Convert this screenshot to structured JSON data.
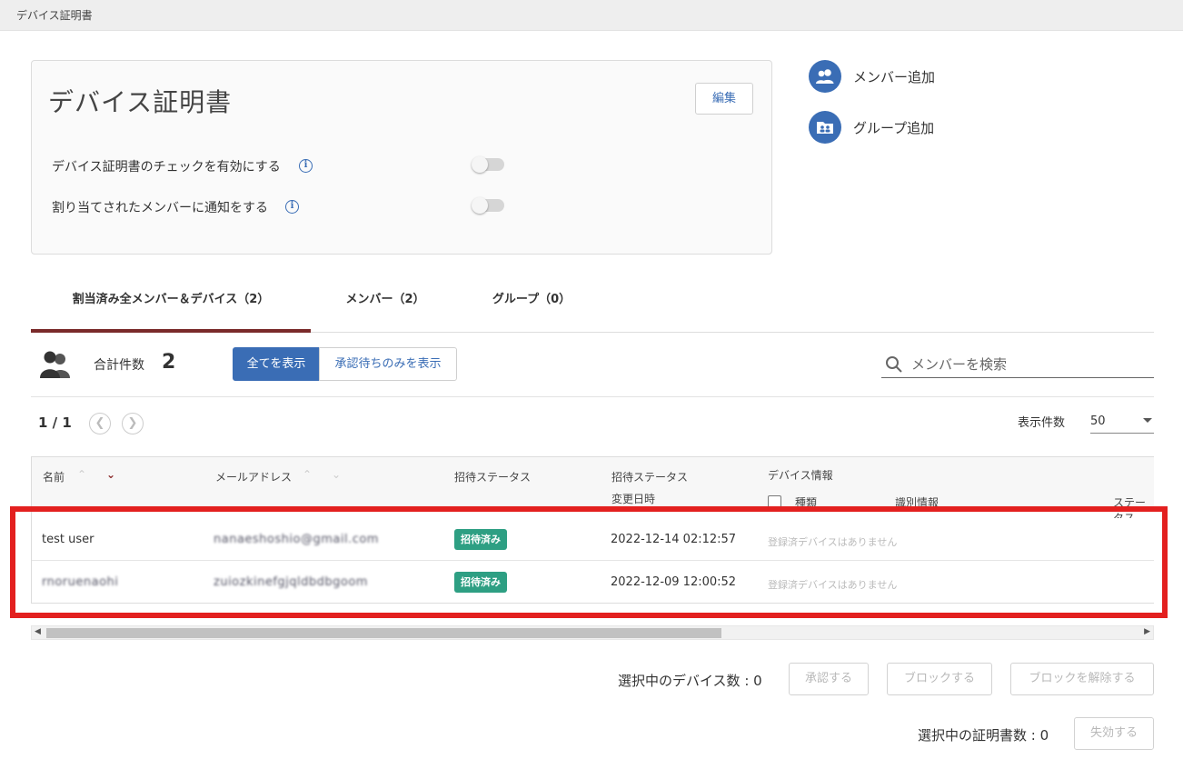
{
  "breadcrumb": "デバイス証明書",
  "card": {
    "title": "デバイス証明書",
    "edit_label": "編集",
    "settings": [
      {
        "label": "デバイス証明書のチェックを有効にする",
        "enabled": false
      },
      {
        "label": "割り当てされたメンバーに通知をする",
        "enabled": false
      }
    ]
  },
  "actions": {
    "add_member": "メンバー追加",
    "add_group": "グループ追加"
  },
  "tabs": [
    {
      "label": "割当済み全メンバー＆デバイス（2）",
      "active": true
    },
    {
      "label": "メンバー（2）",
      "active": false
    },
    {
      "label": "グループ（0）",
      "active": false
    }
  ],
  "summary": {
    "total_label": "合計件数",
    "total_count": "2",
    "filter_all": "全てを表示",
    "filter_pending": "承認待ちのみを表示"
  },
  "search": {
    "placeholder": "メンバーを検索"
  },
  "pagination": {
    "label": "1 / 1",
    "per_page_label": "表示件数",
    "per_page_value": "50"
  },
  "table": {
    "columns": {
      "name": "名前",
      "email": "メールアドレス",
      "invite_status": "招待ステータス",
      "status_changed_1": "招待ステータス",
      "status_changed_2": "変更日時",
      "device_info": "デバイス情報",
      "device_type": "種類",
      "device_id": "識別情報",
      "device_status": "ステータス"
    },
    "rows": [
      {
        "name": "test user",
        "email": "nanaeshoshio@gmail.com",
        "status": "招待済み",
        "changed": "2022-12-14 02:12:57",
        "devices": "登録済デバイスはありません"
      },
      {
        "name": "rnoruenaohi",
        "email": "zuiozkinefgjqldbdbgoom",
        "status": "招待済み",
        "changed": "2022-12-09 12:00:52",
        "devices": "登録済デバイスはありません"
      }
    ]
  },
  "footer": {
    "selected_devices_label": "選択中のデバイス数 : 0",
    "approve": "承認する",
    "block": "ブロックする",
    "unblock": "ブロックを解除する",
    "selected_certs_label": "選択中の証明書数 : 0",
    "revoke": "失効する"
  },
  "colors": {
    "accent": "#3a6db5",
    "tab_active": "#7a2a2a",
    "badge": "#2e9f83",
    "highlight": "#e3201f"
  }
}
